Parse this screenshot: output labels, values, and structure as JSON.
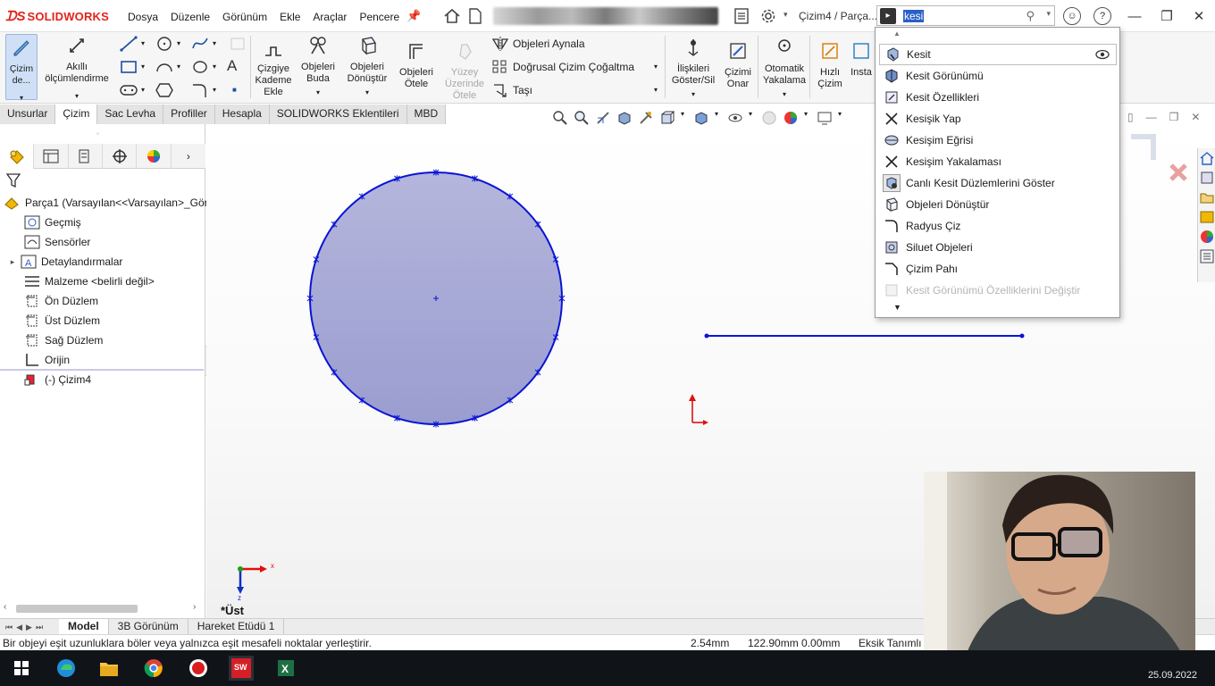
{
  "app": {
    "brand": "SOLIDWORKS",
    "document_title": "Çizim4 / Parça...",
    "menus": [
      "Dosya",
      "Düzenle",
      "Görünüm",
      "Ekle",
      "Araçlar",
      "Pencere"
    ]
  },
  "search": {
    "query": "kesi"
  },
  "command_manager": {
    "sketch_button": "Çizim de...",
    "smart_dimension": "Akıllı ölçümlendirme",
    "offset_on_surface_1": "Çizgiye",
    "offset_on_surface_2": "Kademe",
    "offset_on_surface_3": "Ekle",
    "trim_1": "Objeleri",
    "trim_2": "Buda",
    "convert_1": "Objeleri",
    "convert_2": "Dönüştür",
    "offset_1": "Objeleri",
    "offset_2": "Ötele",
    "surface_offset_1": "Yüzey",
    "surface_offset_2": "Üzerinde",
    "surface_offset_3": "Ötele",
    "mirror": "Objeleri Aynala",
    "linear_pattern": "Doğrusal Çizim Çoğaltma",
    "move": "Taşı",
    "relations_1": "İlişkileri",
    "relations_2": "Göster/Sil",
    "repair_1": "Çizimi",
    "repair_2": "Onar",
    "snap_1": "Otomatik",
    "snap_2": "Yakalama",
    "rapid_1": "Hızlı",
    "rapid_2": "Çizim",
    "instant": "Insta"
  },
  "tabs": [
    "Unsurlar",
    "Çizim",
    "Sac Levha",
    "Profiller",
    "Hesapla",
    "SOLIDWORKS Eklentileri",
    "MBD"
  ],
  "active_tab": "Çizim",
  "feature_tree": {
    "root": "Parça1  (Varsayılan<<Varsayılan>_Gör",
    "items": [
      {
        "label": "Geçmiş",
        "icon": "history-icon"
      },
      {
        "label": "Sensörler",
        "icon": "sensor-icon"
      },
      {
        "label": "Detaylandırmalar",
        "icon": "annotation-icon"
      },
      {
        "label": "Malzeme <belirli değil>",
        "icon": "material-icon"
      },
      {
        "label": "Ön Düzlem",
        "icon": "plane-icon"
      },
      {
        "label": "Üst Düzlem",
        "icon": "plane-icon"
      },
      {
        "label": "Sağ Düzlem",
        "icon": "plane-icon"
      },
      {
        "label": "Orijin",
        "icon": "origin-icon"
      },
      {
        "label": "(-) Çizim4",
        "icon": "sketch-icon"
      }
    ]
  },
  "dropdown": {
    "items": [
      {
        "label": "Kesit",
        "icon": "section-view-icon",
        "highlight": true
      },
      {
        "label": "Kesit Görünümü",
        "icon": "section-view-icon"
      },
      {
        "label": "Kesit Özellikleri",
        "icon": "section-properties-icon"
      },
      {
        "label": "Kesişik Yap",
        "icon": "intersect-icon"
      },
      {
        "label": "Kesişim Eğrisi",
        "icon": "intersection-curve-icon"
      },
      {
        "label": "Kesişim Yakalaması",
        "icon": "intersect-snap-icon"
      },
      {
        "label": "Canlı Kesit Düzlemlerini Göster",
        "icon": "live-section-icon"
      },
      {
        "label": "Objeleri Dönüştür",
        "icon": "convert-entities-icon"
      },
      {
        "label": "Radyus Çiz",
        "icon": "fillet-icon"
      },
      {
        "label": "Siluet Objeleri",
        "icon": "silhouette-icon"
      },
      {
        "label": "Çizim Pahı",
        "icon": "chamfer-icon"
      },
      {
        "label": "Kesit Görünümü Özelliklerini Değiştir",
        "icon": "section-properties-icon",
        "disabled": true
      }
    ]
  },
  "view": {
    "orientation_label": "*Üst"
  },
  "bottom_tabs": [
    "Model",
    "3B Görünüm",
    "Hareket Etüdü 1"
  ],
  "status": {
    "message": "Bir objeyi eşit uzunluklara böler veya yalnızca eşit mesafeli noktalar yerleştirir.",
    "coord_1": "2.54mm",
    "coord_2": "122.90mm  0.00mm",
    "state": "Eksik Tanımlı"
  },
  "taskbar": {
    "date": "25.09.2022"
  },
  "colors": {
    "sketch_blue": "#0a14d6",
    "circle_fill": "#a9acd6",
    "accent_red": "#e2231a",
    "selection_blue": "#2a5fc7"
  }
}
